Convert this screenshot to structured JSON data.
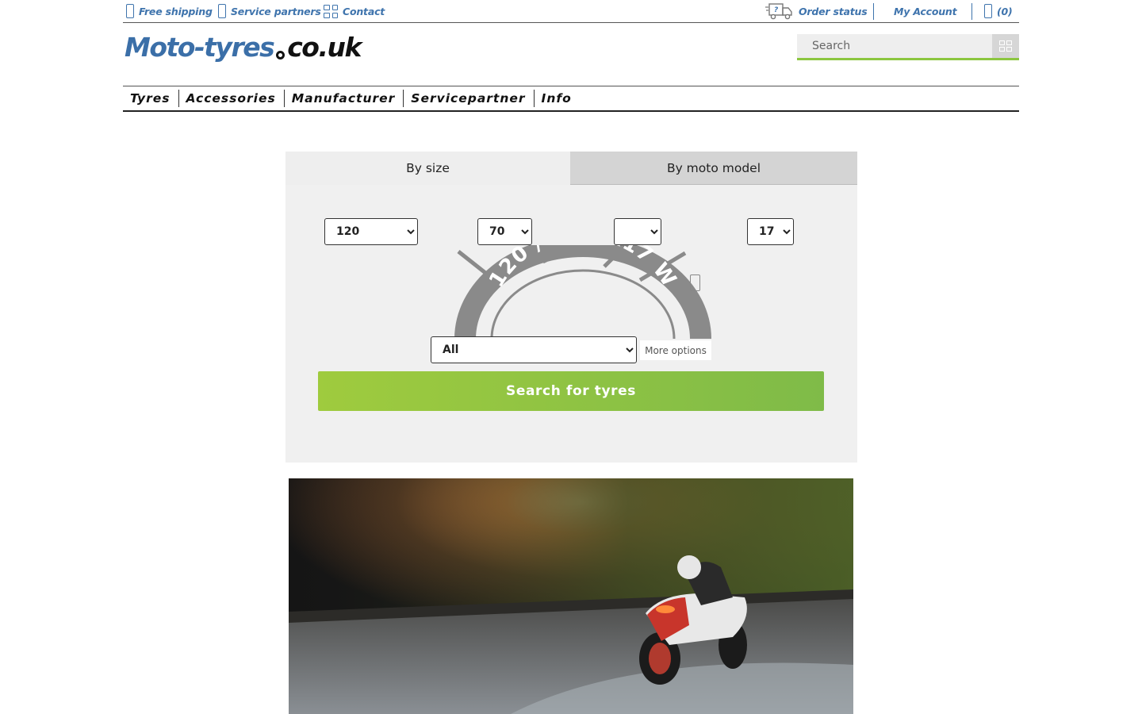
{
  "topbar": {
    "free_shipping": "Free shipping",
    "service_partners": "Service partners",
    "contact": "Contact",
    "order_status": "Order status",
    "my_account": "My Account",
    "cart_count": "(0)"
  },
  "header": {
    "logo_part1": "Moto-tyres",
    "logo_part2": "co.uk",
    "search_placeholder": "Search"
  },
  "nav": {
    "items": [
      "Tyres",
      "Accessories",
      "Manufacturer",
      "Servicepartner",
      "Info"
    ]
  },
  "finder": {
    "tab_size": "By size",
    "tab_model": "By moto model",
    "width_value": "120",
    "ratio_value": "70",
    "construction_value": "",
    "rim_value": "17",
    "tyre_label": "120 / 70 ZR17 W",
    "option_value": "All",
    "more_options": "More options",
    "search_button": "Search for tyres"
  },
  "colors": {
    "brand_blue": "#3f74ad",
    "accent_green": "#8cc63f",
    "tyre_grey": "#8a8a8a"
  },
  "icons": {
    "free_shipping": "truck-icon",
    "service_partners": "wrench-icon",
    "contact": "grid-icon",
    "order_status": "delivery-truck-icon",
    "my_account": "user-icon",
    "cart": "cart-icon",
    "search": "search-icon",
    "camera": "camera-icon"
  }
}
